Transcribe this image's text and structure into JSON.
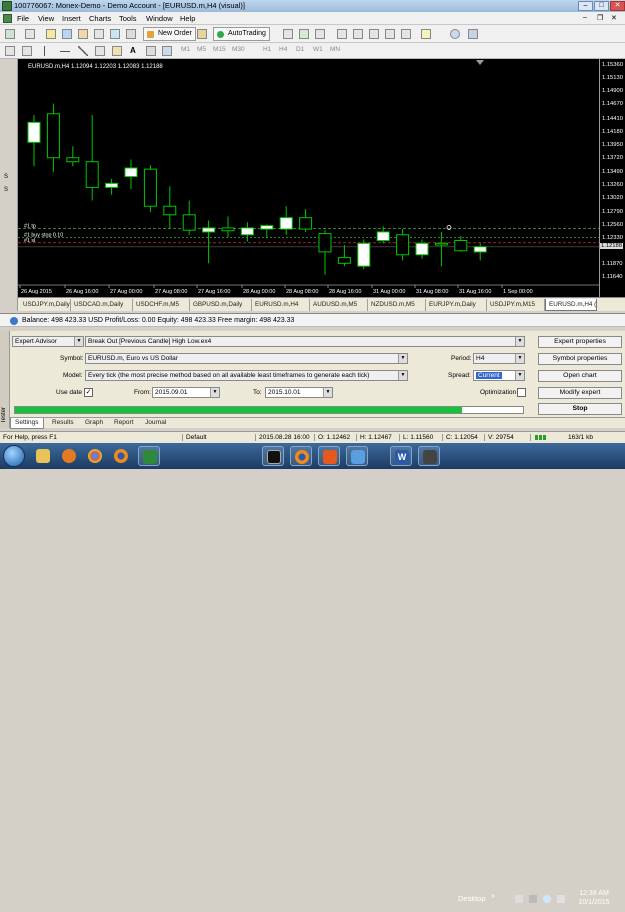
{
  "window": {
    "title": "100776067: Monex-Demo - Demo Account - [EURUSD.m,H4 (visual)]"
  },
  "menu": [
    "File",
    "View",
    "Insert",
    "Charts",
    "Tools",
    "Window",
    "Help"
  ],
  "toolbar": {
    "new_order": "New Order",
    "autotrading": "AutoTrading",
    "timeframes": [
      "M1",
      "M5",
      "M15",
      "M30",
      "H1",
      "H4",
      "D1",
      "W1",
      "MN"
    ]
  },
  "chart": {
    "header": "EURUSD.m,H4  1.12094 1.12203 1.12083 1.12188",
    "price_labels": [
      "1.15360",
      "1.15130",
      "1.14900",
      "1.14670",
      "1.14410",
      "1.14180",
      "1.13950",
      "1.13720",
      "1.13490",
      "1.13260",
      "1.13020",
      "1.12790",
      "1.12560",
      "1.12330",
      "1.12188",
      "1.11870",
      "1.11640"
    ],
    "current_price": "1.12188",
    "order_lines": [
      "#1 tp",
      "#1 buy stop 0.10",
      "#1 sl"
    ],
    "time_labels": [
      "26 Aug 2015",
      "26 Aug 16:00",
      "27 Aug 00:00",
      "27 Aug 08:00",
      "27 Aug 16:00",
      "28 Aug 00:00",
      "28 Aug 08:00",
      "28 Aug 16:00",
      "31 Aug 00:00",
      "31 Aug 08:00",
      "31 Aug 16:00",
      "1 Sep 00:00"
    ],
    "colors": {
      "bull": "#ffffff",
      "bear": "#000000",
      "wick": "#00c800",
      "background": "#000000",
      "tp_line": "#3cb03c",
      "entry_line": "#3cb03c",
      "sl_line": "#d03030"
    }
  },
  "chart_data": {
    "type": "candlestick",
    "title": "EURUSD.m,H4",
    "ylim": [
      1.1152,
      1.1548
    ],
    "candles": [
      {
        "o": 1.1402,
        "h": 1.145,
        "l": 1.136,
        "c": 1.1437
      },
      {
        "o": 1.1452,
        "h": 1.147,
        "l": 1.135,
        "c": 1.1375
      },
      {
        "o": 1.1375,
        "h": 1.1395,
        "l": 1.136,
        "c": 1.1368
      },
      {
        "o": 1.1368,
        "h": 1.145,
        "l": 1.13,
        "c": 1.1323
      },
      {
        "o": 1.1323,
        "h": 1.1338,
        "l": 1.131,
        "c": 1.133
      },
      {
        "o": 1.1342,
        "h": 1.1372,
        "l": 1.132,
        "c": 1.1357
      },
      {
        "o": 1.1355,
        "h": 1.1362,
        "l": 1.128,
        "c": 1.129
      },
      {
        "o": 1.129,
        "h": 1.1325,
        "l": 1.125,
        "c": 1.1275
      },
      {
        "o": 1.1275,
        "h": 1.13,
        "l": 1.124,
        "c": 1.1248
      },
      {
        "o": 1.1245,
        "h": 1.1265,
        "l": 1.119,
        "c": 1.1252
      },
      {
        "o": 1.1252,
        "h": 1.1272,
        "l": 1.1235,
        "c": 1.1247
      },
      {
        "o": 1.124,
        "h": 1.1262,
        "l": 1.1228,
        "c": 1.1252
      },
      {
        "o": 1.125,
        "h": 1.1258,
        "l": 1.1235,
        "c": 1.1256
      },
      {
        "o": 1.125,
        "h": 1.129,
        "l": 1.124,
        "c": 1.127
      },
      {
        "o": 1.127,
        "h": 1.1285,
        "l": 1.1245,
        "c": 1.125
      },
      {
        "o": 1.1242,
        "h": 1.1248,
        "l": 1.117,
        "c": 1.121
      },
      {
        "o": 1.12,
        "h": 1.1222,
        "l": 1.1185,
        "c": 1.119
      },
      {
        "o": 1.1185,
        "h": 1.1232,
        "l": 1.118,
        "c": 1.1225
      },
      {
        "o": 1.123,
        "h": 1.1255,
        "l": 1.1225,
        "c": 1.1245
      },
      {
        "o": 1.124,
        "h": 1.125,
        "l": 1.1195,
        "c": 1.1205
      },
      {
        "o": 1.1205,
        "h": 1.1232,
        "l": 1.1198,
        "c": 1.1225
      },
      {
        "o": 1.1225,
        "h": 1.1245,
        "l": 1.1185,
        "c": 1.1222
      },
      {
        "o": 1.123,
        "h": 1.1238,
        "l": 1.121,
        "c": 1.1212
      },
      {
        "o": 1.121,
        "h": 1.1225,
        "l": 1.1195,
        "c": 1.1219
      }
    ],
    "levels": {
      "tp": 1.1251,
      "buy_stop": 1.1235,
      "sl": 1.1226
    }
  },
  "symbol_tabs": [
    "USDJPY.m,Daily",
    "USDCAD.m,Daily",
    "USDCHF.m,M5",
    "GBPUSD.m,Daily",
    "EURUSD.m,H4",
    "AUDUSD.m,M5",
    "NZDUSD.m,M5",
    "EURJPY.m,Daily",
    "USDJPY.m,M15",
    "EURUSD.m,H4 (v"
  ],
  "active_symbol_tab": 9,
  "account": {
    "text": "Balance: 498 423.33 USD  Profit/Loss: 0.00  Equity: 498 423.33  Free margin: 498 423.33"
  },
  "tester": {
    "type_value": "Expert Advisor",
    "expert_value": "Break Out [Previous Candle] High Low.ex4",
    "symbol_label": "Symbol:",
    "symbol_value": "EURUSD.m, Euro vs US Dollar",
    "model_label": "Model:",
    "model_value": "Every tick (the most precise method based on all available least timeframes to generate each tick)",
    "use_date_label": "Use date",
    "use_date_checked": true,
    "from_label": "From:",
    "from_value": "2015.09.01",
    "to_label": "To:",
    "to_value": "2015.10.01",
    "period_label": "Period:",
    "period_value": "H4",
    "spread_label": "Spread:",
    "spread_value": "Current",
    "optimization_label": "Optimization",
    "buttons": [
      "Expert properties",
      "Symbol properties",
      "Open chart",
      "Modify expert",
      "Stop"
    ],
    "progress": 0.88
  },
  "bottom_tabs": [
    "Settings",
    "Results",
    "Graph",
    "Report",
    "Journal"
  ],
  "status": {
    "help": "For Help, press F1",
    "profile": "Default",
    "datetime": "2015.08.28 16:00",
    "open": "O: 1.12462",
    "high": "H: 1.12467",
    "low": "L: 1.11560",
    "close": "C: 1.12054",
    "volume": "V: 29754",
    "traffic": "163/1 kb"
  },
  "taskbar": {
    "desktop_label": "Desktop",
    "time": "12:38 AM",
    "date": "10/1/2015",
    "apps": [
      "windows-explorer",
      "media-player",
      "chrome",
      "firefox",
      "metatrader",
      "monex",
      "firefox-alt",
      "teamviewer",
      "word",
      "terminal",
      "paint"
    ]
  }
}
